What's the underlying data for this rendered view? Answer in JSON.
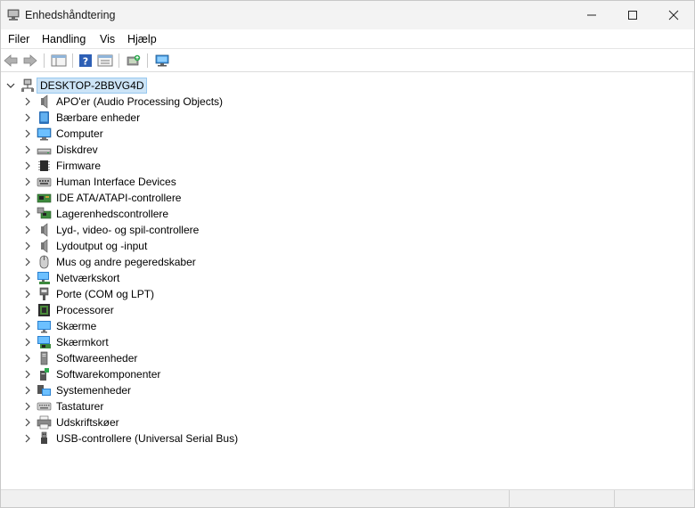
{
  "window": {
    "title": "Enhedshåndtering"
  },
  "menu": [
    "Filer",
    "Handling",
    "Vis",
    "Hjælp"
  ],
  "tree": {
    "root": "DESKTOP-2BBVG4D",
    "items": [
      {
        "label": "APO'er (Audio Processing Objects)",
        "icon": "speaker-icon"
      },
      {
        "label": "Bærbare enheder",
        "icon": "portable-device-icon"
      },
      {
        "label": "Computer",
        "icon": "computer-icon"
      },
      {
        "label": "Diskdrev",
        "icon": "disk-drive-icon"
      },
      {
        "label": "Firmware",
        "icon": "firmware-chip-icon"
      },
      {
        "label": "Human Interface Devices",
        "icon": "hid-icon"
      },
      {
        "label": "IDE ATA/ATAPI-controllere",
        "icon": "ide-controller-icon"
      },
      {
        "label": "Lagerenhedscontrollere",
        "icon": "storage-controller-icon"
      },
      {
        "label": "Lyd-, video- og spil-controllere",
        "icon": "speaker-icon"
      },
      {
        "label": "Lydoutput og -input",
        "icon": "speaker-icon"
      },
      {
        "label": "Mus og andre pegeredskaber",
        "icon": "mouse-icon"
      },
      {
        "label": "Netværkskort",
        "icon": "network-adapter-icon"
      },
      {
        "label": "Porte (COM og LPT)",
        "icon": "port-icon"
      },
      {
        "label": "Processorer",
        "icon": "processor-icon"
      },
      {
        "label": "Skærme",
        "icon": "monitor-icon"
      },
      {
        "label": "Skærmkort",
        "icon": "display-adapter-icon"
      },
      {
        "label": "Softwareenheder",
        "icon": "software-device-icon"
      },
      {
        "label": "Softwarekomponenter",
        "icon": "software-component-icon"
      },
      {
        "label": "Systemenheder",
        "icon": "system-device-icon"
      },
      {
        "label": "Tastaturer",
        "icon": "keyboard-icon"
      },
      {
        "label": "Udskriftskøer",
        "icon": "printer-icon"
      },
      {
        "label": "USB-controllere (Universal Serial Bus)",
        "icon": "usb-icon"
      }
    ]
  },
  "colors": {
    "selection": "#cce4f7",
    "accent": "#3c8fd8"
  }
}
